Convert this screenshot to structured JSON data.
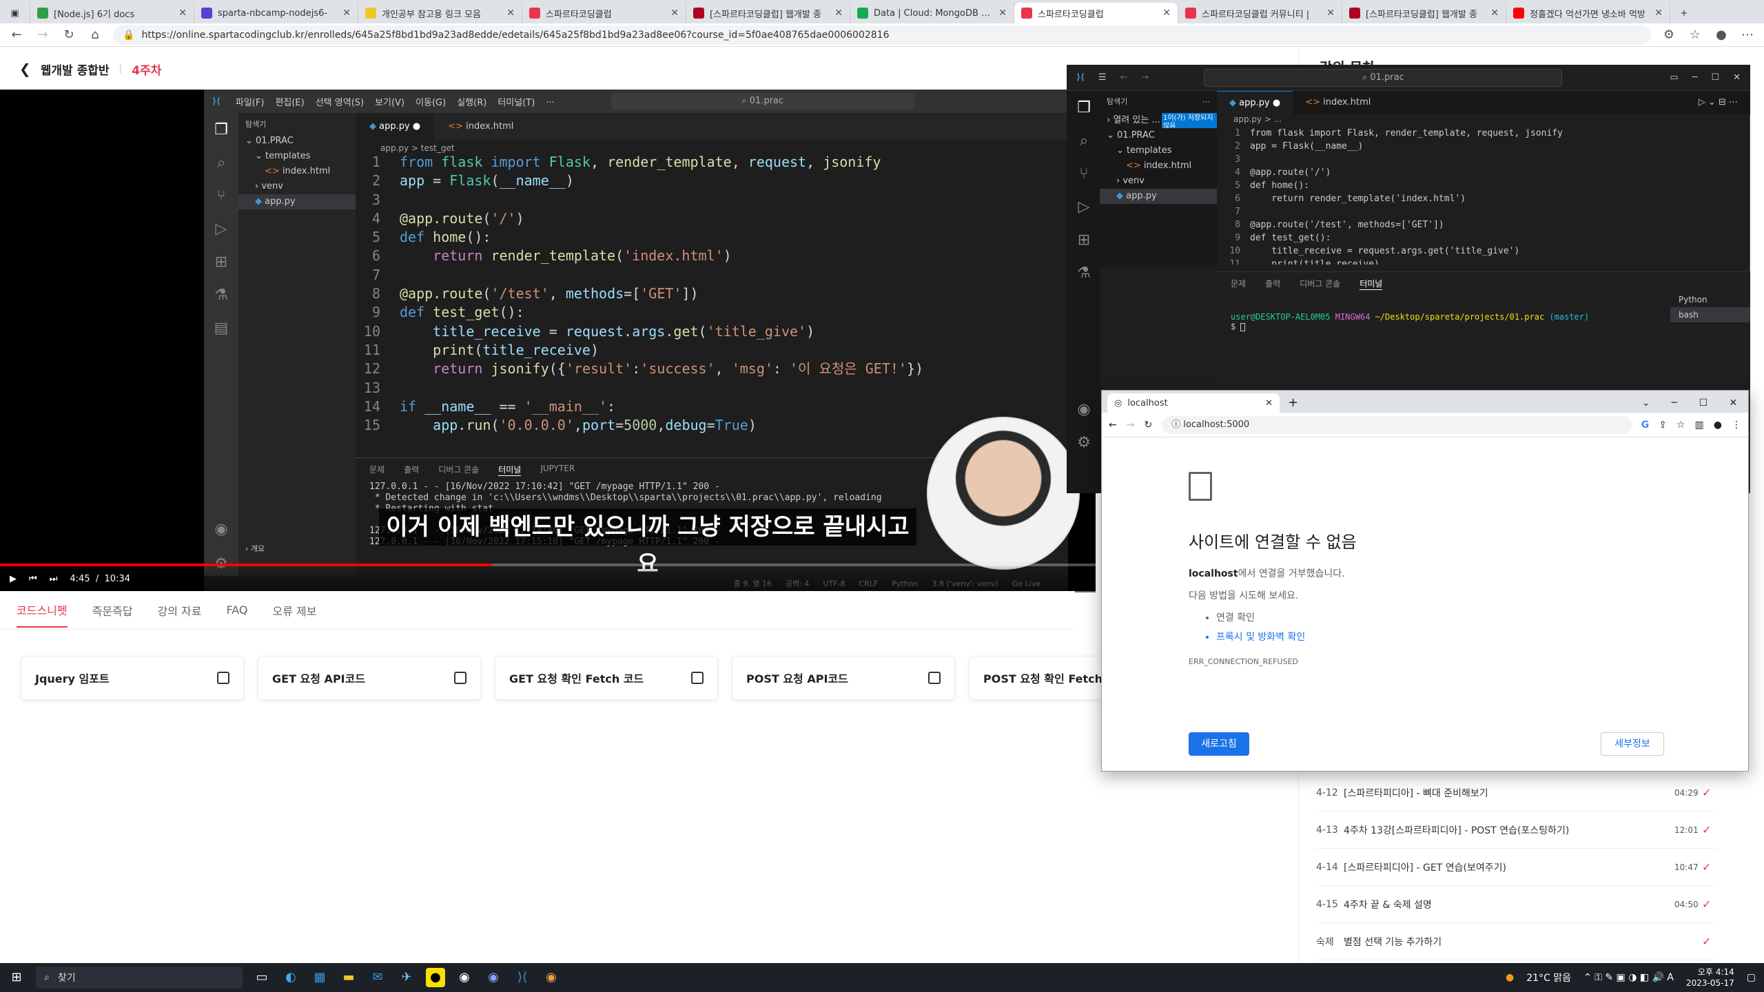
{
  "browser": {
    "tabs": [
      {
        "label": "[Node.js] 6기 docs",
        "color": "#2e9e49"
      },
      {
        "label": "sparta-nbcamp-nodejs6-",
        "color": "#5b3fd1"
      },
      {
        "label": "개인공부 참고용 링크 모음",
        "color": "#f3c623"
      },
      {
        "label": "스파르타코딩클럽",
        "color": "#e8344e"
      },
      {
        "label": "[스파르타코딩클럽] 웹개발 종",
        "color": "#b00020"
      },
      {
        "label": "Data | Cloud: MongoDB Cloud",
        "color": "#13aa52"
      },
      {
        "label": "스파르타코딩클럽",
        "color": "#e8344e"
      },
      {
        "label": "스파르타코딩클럽 커뮤니티 |",
        "color": "#e8344e"
      },
      {
        "label": "[스파르타코딩클럽] 웹개발 종",
        "color": "#b00020"
      },
      {
        "label": "정흘겠다 억선가면 냉소바 먹방",
        "color": "#ff0000"
      }
    ],
    "url": "https://online.spartacodingclub.kr/enrolleds/645a25f8bd1bd9a23ad8edde/edetails/645a25f8bd1bd9a23ad8ee06?course_id=5f0ae408765dae0006002816"
  },
  "page": {
    "course_title": "웹개발 종합반",
    "week": "4주차"
  },
  "video": {
    "current_time": "4:45",
    "duration": "10:34",
    "progress": 0.449,
    "subtitle": "이거 이제 백엔드만 있으니까 그냥 저장으로 끝내시고요"
  },
  "vscode_left": {
    "menu": [
      "파일(F)",
      "편집(E)",
      "선택 영역(S)",
      "보기(V)",
      "이동(G)",
      "실행(R)",
      "터미널(T)",
      "..."
    ],
    "search": "01.prac",
    "explorer_title": "탐색기",
    "tree": [
      "01.PRAC",
      "templates",
      "index.html",
      "venv",
      "app.py"
    ],
    "outline": "개요",
    "tabs": [
      "app.py",
      "index.html"
    ],
    "breadcrumb": "app.py > test_get",
    "panel_tabs": [
      "문제",
      "출력",
      "디버그 콘솔",
      "터미널",
      "JUPYTER"
    ],
    "terminal_lines": [
      "127.0.0.1 - - [16/Nov/2022 17:10:42] \"GET /mypage HTTP/1.1\" 200 -",
      " * Detected change in 'c:\\\\Users\\\\wndms\\\\Desktop\\\\sparta\\\\projects\\\\01.prac\\\\app.py', reloading",
      " * Restarting with stat",
      "",
      "127.0.0.1 - - [16/Nov/2022 17:14:40] \"GET /mypage HTTP/1.1\" 200 -",
      "127.0.0.1 - - [16/Nov/2022 17:15:10] \"GET /mypage HTTP/1.1\" 200 -"
    ],
    "status": [
      "줄 9, 열 16",
      "공백: 4",
      "UTF-8",
      "CRLF",
      "Python",
      "3.8 ('venv': venv)",
      "Go Live"
    ]
  },
  "lower_tabs": [
    "코드스니펫",
    "즉문즉답",
    "강의 자료",
    "FAQ",
    "오류 제보"
  ],
  "snippets": [
    "Jquery 임포트",
    "GET 요청 API코드",
    "GET 요청 확인 Fetch 코드",
    "POST 요청 API코드",
    "POST 요청 확인 Fetch코드"
  ],
  "course_panel": {
    "title": "강의 목차",
    "lessons": [
      {
        "num": "4-12",
        "title": "[스파르타피디아] - 뼈대 준비해보기",
        "duration": "04:29"
      },
      {
        "num": "4-13",
        "title": "4주차 13강[스파르타피디아] - POST 연습(포스팅하기)",
        "duration": "12:01"
      },
      {
        "num": "4-14",
        "title": "[스파르타피디아] - GET 연습(보여주기)",
        "duration": "10:47"
      },
      {
        "num": "4-15",
        "title": "4주차 끝 & 숙제 설명",
        "duration": "04:50"
      },
      {
        "num": "숙제",
        "title": "별점 선택 기능 추가하기",
        "duration": ""
      }
    ]
  },
  "vscode_right": {
    "search": "01.prac",
    "explorer_title": "탐색기",
    "open_editors": "열려 있는 ...",
    "badge": "1이(가) 저장되지 않음",
    "tree": [
      "01.PRAC",
      "templates",
      "index.html",
      "venv",
      "app.py"
    ],
    "tabs": [
      "app.py",
      "index.html"
    ],
    "breadcrumb": "app.py > ...",
    "code": [
      "from flask import Flask, render_template, request, jsonify",
      "app = Flask(__name__)",
      "",
      "@app.route('/')",
      "def home():",
      "    return render_template('index.html')",
      "",
      "@app.route('/test', methods=['GET'])",
      "def test_get():",
      "    title_receive = request.args.get('title_give')",
      "    print(title_receive)"
    ],
    "panel_tabs": [
      "문제",
      "출력",
      "디버그 콘솔",
      "터미널"
    ],
    "prompt_user": "user@DESKTOP-AEL0M05",
    "prompt_env": "MINGW64",
    "prompt_path": "~/Desktop/spareta/projects/01.prac",
    "prompt_branch": "(master)",
    "prompt_symbol": "$",
    "shells": [
      "Python",
      "bash"
    ]
  },
  "chrome_popup": {
    "tab_title": "localhost",
    "url": "localhost:5000",
    "heading": "사이트에 연결할 수 없음",
    "host": "localhost",
    "refused": "에서 연결을 거부했습니다.",
    "try": "다음 방법을 시도해 보세요.",
    "suggestions": [
      "연결 확인",
      "프록시 및 방화벽 확인"
    ],
    "error_code": "ERR_CONNECTION_REFUSED",
    "reload": "새로고침",
    "details": "세부정보"
  },
  "taskbar": {
    "search_placeholder": "찾기",
    "weather": "21°C 맑음",
    "time": "오후 4:14",
    "date": "2023-05-17"
  },
  "code": [
    [
      [
        "kw",
        "from "
      ],
      [
        "ct",
        "flask "
      ],
      [
        "kw",
        "import "
      ],
      [
        "ct",
        "Flask"
      ],
      [
        "",
        ", "
      ],
      [
        "fn",
        "render_template"
      ],
      [
        "",
        ", "
      ],
      [
        "vr",
        "request"
      ],
      [
        "",
        ", "
      ],
      [
        "fn",
        "jsonify"
      ]
    ],
    [
      [
        "vr",
        "app"
      ],
      [
        "",
        " = "
      ],
      [
        "ct",
        "Flask"
      ],
      [
        "",
        "("
      ],
      [
        "vr",
        "__name__"
      ],
      [
        "",
        ")"
      ]
    ],
    [],
    [
      [
        "fn",
        "@app.route"
      ],
      [
        "",
        "("
      ],
      [
        "st",
        "'/'"
      ],
      [
        "",
        ")"
      ]
    ],
    [
      [
        "kw",
        "def "
      ],
      [
        "fn",
        "home"
      ],
      [
        "",
        "():"
      ]
    ],
    [
      [
        "",
        "    "
      ],
      [
        "pk",
        "return "
      ],
      [
        "fn",
        "render_template"
      ],
      [
        "",
        "("
      ],
      [
        "st",
        "'index.html'"
      ],
      [
        "",
        ")"
      ]
    ],
    [],
    [
      [
        "fn",
        "@app.route"
      ],
      [
        "",
        "("
      ],
      [
        "st",
        "'/test'"
      ],
      [
        "",
        ", "
      ],
      [
        "vr",
        "methods"
      ],
      [
        "",
        "=["
      ],
      [
        "st",
        "'GET'"
      ],
      [
        "",
        "])"
      ]
    ],
    [
      [
        "kw",
        "def "
      ],
      [
        "fn",
        "test_get"
      ],
      [
        "",
        "():"
      ]
    ],
    [
      [
        "",
        "    "
      ],
      [
        "vr",
        "title_receive"
      ],
      [
        "",
        " = "
      ],
      [
        "vr",
        "request"
      ],
      [
        "",
        "."
      ],
      [
        "vr",
        "args"
      ],
      [
        "",
        "."
      ],
      [
        "fn",
        "get"
      ],
      [
        "",
        "("
      ],
      [
        "st",
        "'title_give'"
      ],
      [
        "",
        ")"
      ]
    ],
    [
      [
        "",
        "    "
      ],
      [
        "fn",
        "print"
      ],
      [
        "",
        "("
      ],
      [
        "vr",
        "title_receive"
      ],
      [
        "",
        ")"
      ]
    ],
    [
      [
        "",
        "    "
      ],
      [
        "pk",
        "return "
      ],
      [
        "fn",
        "jsonify"
      ],
      [
        "",
        "({"
      ],
      [
        "st",
        "'result'"
      ],
      [
        "",
        ":"
      ],
      [
        "st",
        "'success'"
      ],
      [
        "",
        ", "
      ],
      [
        "st",
        "'msg'"
      ],
      [
        "",
        ": "
      ],
      [
        "st",
        "'이 요청은 GET!'"
      ],
      [
        "",
        "})"
      ]
    ],
    [],
    [
      [
        "kw",
        "if "
      ],
      [
        "vr",
        "__name__"
      ],
      [
        "",
        " == "
      ],
      [
        "st",
        "'__main__'"
      ],
      [
        "",
        ":"
      ]
    ],
    [
      [
        "",
        "    "
      ],
      [
        "vr",
        "app"
      ],
      [
        "",
        "."
      ],
      [
        "fn",
        "run"
      ],
      [
        "",
        "("
      ],
      [
        "st",
        "'0.0.0.0'"
      ],
      [
        "",
        ","
      ],
      [
        "vr",
        "port"
      ],
      [
        "",
        "="
      ],
      [
        "nu",
        "5000"
      ],
      [
        "",
        ","
      ],
      [
        "vr",
        "debug"
      ],
      [
        "",
        "="
      ],
      [
        "kw",
        "True"
      ],
      [
        "",
        ")"
      ]
    ]
  ]
}
